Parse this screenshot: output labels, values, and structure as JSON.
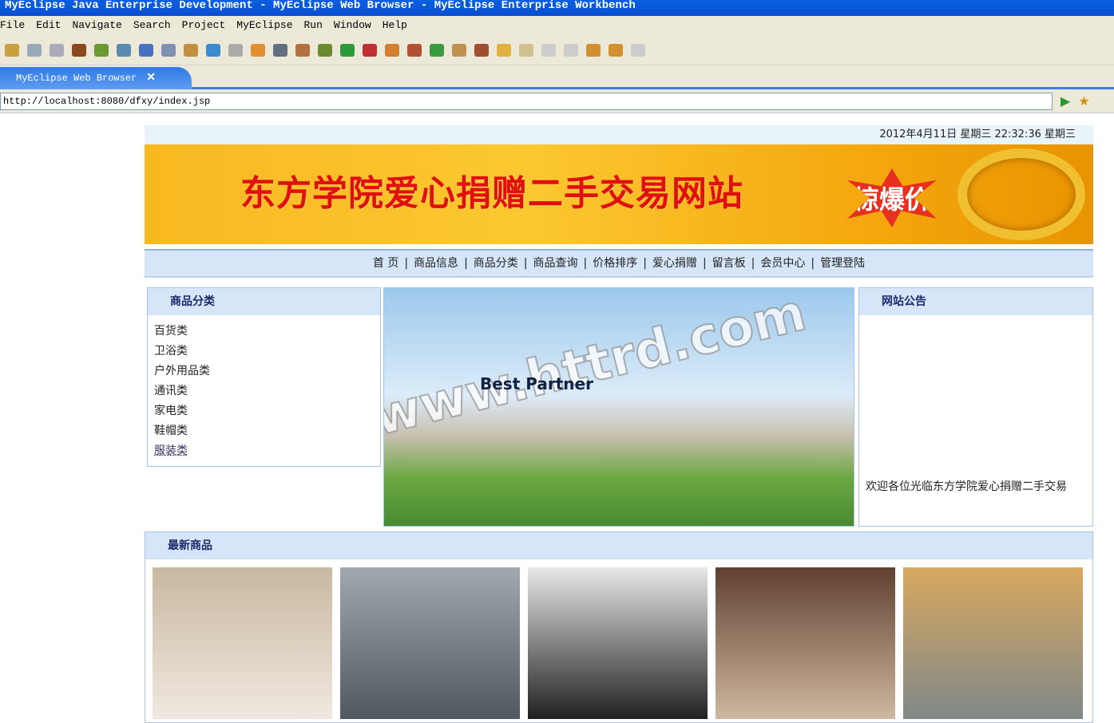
{
  "window": {
    "title": "MyEclipse Java Enterprise Development - MyEclipse Web Browser - MyEclipse Enterprise Workbench"
  },
  "menu": [
    "File",
    "Edit",
    "Navigate",
    "Search",
    "Project",
    "MyEclipse",
    "Run",
    "Window",
    "Help"
  ],
  "tab": {
    "label": "MyEclipse Web Browser",
    "close": "✕"
  },
  "address": {
    "url": "http://localhost:8080/dfxy/index.jsp"
  },
  "site": {
    "datetime": "2012年4月11日 星期三 22:32:36   星期三",
    "banner_title": "东方学院爱心捐赠二手交易网站",
    "banner_badge": "惊爆价",
    "nav": [
      "首 页",
      "商品信息",
      "商品分类",
      "商品查询",
      "价格排序",
      "爱心捐赠",
      "留言板",
      "会员中心",
      "管理登陆"
    ],
    "category": {
      "title": "商品分类",
      "items": [
        "百货类",
        "卫浴类",
        "户外用品类",
        "通讯类",
        "家电类",
        "鞋帽类",
        "服装类"
      ]
    },
    "slide": {
      "watermark": "www.httrd.com",
      "caption": "Best Partner"
    },
    "notice": {
      "title": "网站公告",
      "text": "欢迎各位光临东方学院爱心捐赠二手交易"
    },
    "latest": {
      "title": "最新商品"
    }
  }
}
